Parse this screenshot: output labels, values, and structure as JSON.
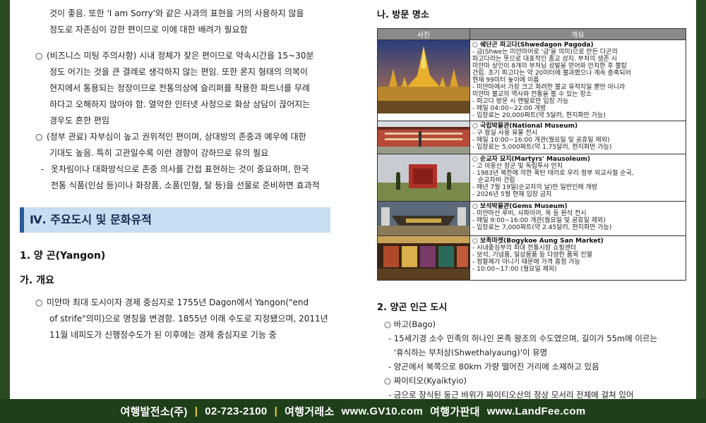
{
  "left": {
    "p1_lines": [
      "것이 좋음. 또한 'I am Sorry'와 같은 사과의 표현을 거의 사용하지 않을",
      "정도로 자존심이 강한 편이므로 이에 대한 배려가 필요함"
    ],
    "p2_bullet": "○",
    "p2_lines": [
      "(비즈니스 미팅 주의사항) 시내 정체가 잦은 편이므로 약속시간을 15~30분",
      "정도 어기는 것을 큰 결례로 생각하지 않는 편임. 또한 론지 형태의 의복이",
      "현지에서 통용되는 정장이므로 전통의상에 슬리퍼를 착용한 파트너를 무례",
      "하다고 오해하지 않아야 함. 열악한 인터넷 사정으로 화상 상담이 끊어지는",
      "경우도 흔한 편임"
    ],
    "p3_bullet": "○",
    "p3_lines": [
      "(정부 관료) 자부심이 높고 권위적인 편이며, 상대방의 존중과 예우에 대한",
      "기대도 높음. 특히 고관일수록 이런 경향이 강하므로 유의 필요"
    ],
    "p4_dash": "-",
    "p4_lines": [
      "옷차림이나 대화방식으로 존중 의사를 간접 표현하는 것이 중요하며, 한국",
      "전통 식품(인삼 등)이나 화장품, 소품(인형, 탈 등)을 선물로 준비하면 효과적"
    ],
    "section_title": "Ⅳ. 주요도시 및 문화유적",
    "city_heading": "1. 양  곤(Yangon)",
    "sub_heading": "가. 개요",
    "p5_bullet": "○",
    "p5_lines": [
      "미얀마 최대 도시이자 경제 중심지로 1755년 Dagon에서 Yangon(\"end",
      "of strife\"의미)으로 명칭을 변경함. 1855년 이래 수도로 지정됐으며, 2011년",
      "11월 네피도가 신행정수도가 된 이후에는 경제 중심지로 기능 중"
    ]
  },
  "right": {
    "title": "나. 방문 명소",
    "table_headers": [
      "사진",
      "개요"
    ],
    "places": [
      {
        "name": "○ 쉐단곤 파고다(Shwedagon Pagoda)",
        "lines": [
          "- 금(Shwe는 미얀마어로 '금'을 의미)으로 만든 다곤의",
          "파고다라는 뜻으로 대표적인 종교 성지. 부처의 생존 시",
          "미얀마 상인이 8개의 부처님 성발을 얻어와 안치한 후 불탑",
          "건립. 초기 파고다는 약 20미터에 불과했으나 계속 증축되어",
          "현재 99미터 높이에 이름",
          "- 미얀마에서 가장 크고 화려한 불교 유적지일 뿐만 아니라",
          "미얀마 불교의 역사와 전통을 볼 수 있는 장소",
          "- 파고다 방문 시 맨발로만 입장 가능",
          "- 매일 04:00~22:00 개방",
          "- 입장료는 20,000짜트(약 5달러, 현지화만 가능)"
        ]
      },
      {
        "name": "○ 국립박물관(National Museum)",
        "lines": [
          "- 구 왕실 사용 유물 전시",
          "- 매일 10:00~16:00 개관(월요일 및 공휴일 제외)",
          "- 입장료는 5,000짜트(약 1.75달러, 현지화만 가능)"
        ]
      },
      {
        "name": "○ 순교자 묘지(Martyrs' Mausoleum)",
        "lines": [
          "- 고 아웅산 장군 및 독립투사 안치",
          "- 1983년 북한에 의한 폭탄 테러로 우리 정부 외교사절 순국,",
          "순교자비 건립",
          "- 매년 7월 19일(순교자의 날)만 일반인에 개방",
          "- 2026년 5월 현재 입장 금지"
        ]
      },
      {
        "name": "○ 보석박물관(Gems Museum)",
        "lines": [
          "- 미얀마산 루비, 사파이어, 옥 등 원석 전시",
          "- 매일 9:00~16:00 개관(월요일 및 공휴일 제외)",
          "- 입장료는 7,000짜트(약 2.45달러, 현지화만 가능)"
        ]
      },
      {
        "name": "○ 보족마켓(Bogykoe Aung San Market)",
        "lines": [
          "- 시내중심부의 최대 전통시장 쇼핑센터",
          "- 보석, 기념품, 일상용품 등 다양한 품목 진열",
          "- 정찰제가 아니기 때문에 가격 흥정 가능",
          "- 10:00~17:00 (월요일 제외)"
        ]
      }
    ],
    "h2": "2. 양곤 인근 도시",
    "bago_name": "○ 바고(Bago)",
    "bago_lines": [
      "- 15세기경 소수 민족의 하나인 몬족 왕조의 수도였으며, 길이가 55m에 이르는",
      "'휴식하는 부처상(Shwethalyaung)'이 유명",
      "- 양곤에서 북쪽으로 80km 가량 떨어진 거리에 소재하고 있음"
    ],
    "kyaik_name": "○ 짜이티오(Kyaiktyio)",
    "kyaik_lines": [
      "- 금으로 장식된 둥근 바위가 짜이티오산의 정상 모서리 전체에 걸쳐 있어"
    ]
  },
  "footer": {
    "company": "여행발전소(주)",
    "phone": "02-723-2100",
    "brand1": "여행거래소",
    "site1": "www.GV10.com",
    "brand2": "여행가판대",
    "site2": "www.LandFee.com",
    "sep": "|"
  },
  "colors": {
    "section_bar_bg": "#c9ddf0",
    "section_bar_accent": "#2b5a9a",
    "footer_bg": "#1f3f1a",
    "footer_sep": "#f2d22a",
    "table_header_bg": "#8a8a8a"
  }
}
